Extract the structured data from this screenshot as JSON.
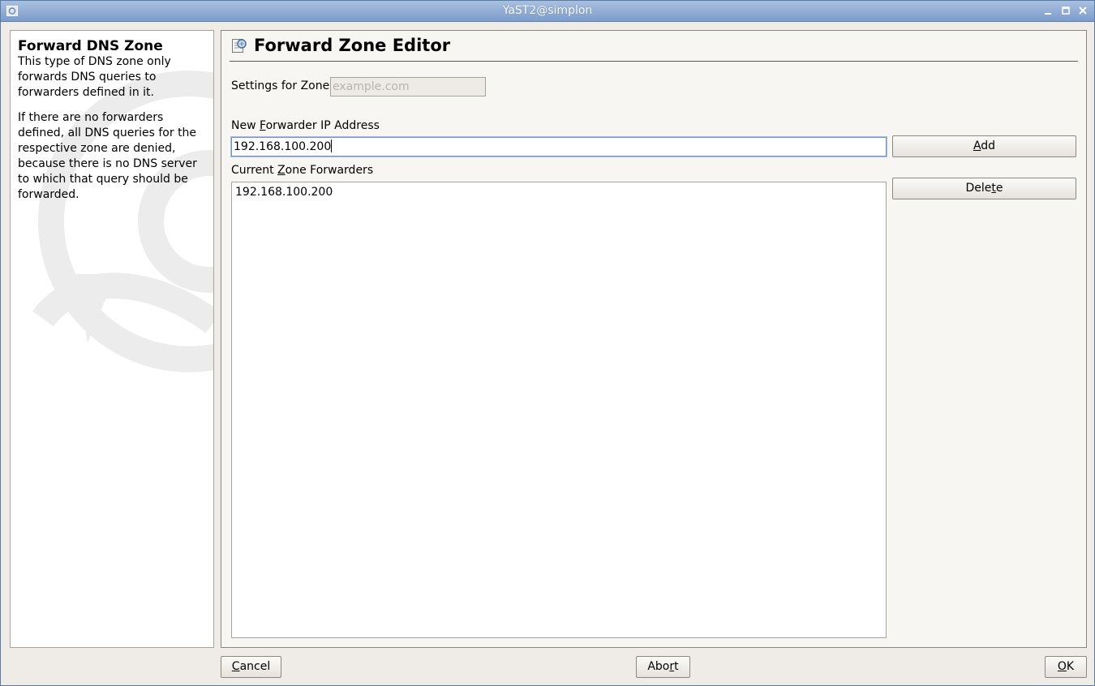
{
  "window": {
    "title": "YaST2@simplon",
    "controls": [
      "minimize-icon",
      "maximize-icon",
      "close-icon"
    ],
    "accent_color": "#7d9ccb"
  },
  "help": {
    "title": "Forward DNS Zone",
    "paragraph1": "This type of DNS zone only forwards DNS queries to forwarders defined in it.",
    "paragraph2": "If there are no forwarders defined, all DNS queries for the respective zone are denied, because there is no DNS server to which that query should be forwarded."
  },
  "editor": {
    "title": "Forward Zone Editor",
    "zone_label": "Settings for Zone",
    "zone_value": "example.com",
    "new_forwarder_label_pre": "New ",
    "new_forwarder_label_mnemonic": "F",
    "new_forwarder_label_post": "orwarder IP Address",
    "new_forwarder_value": "192.168.100.200",
    "add_button_mnemonic": "A",
    "add_button_rest": "dd",
    "current_label_pre": "Current ",
    "current_label_mnemonic": "Z",
    "current_label_post": "one Forwarders",
    "forwarders": [
      "192.168.100.200"
    ],
    "delete_button_pre": "Dele",
    "delete_button_mnemonic": "t",
    "delete_button_post": "e"
  },
  "footer": {
    "cancel_mnemonic": "C",
    "cancel_rest": "ancel",
    "abort_pre": "Abo",
    "abort_mnemonic": "r",
    "abort_post": "t",
    "ok_mnemonic": "O",
    "ok_rest": "K"
  }
}
